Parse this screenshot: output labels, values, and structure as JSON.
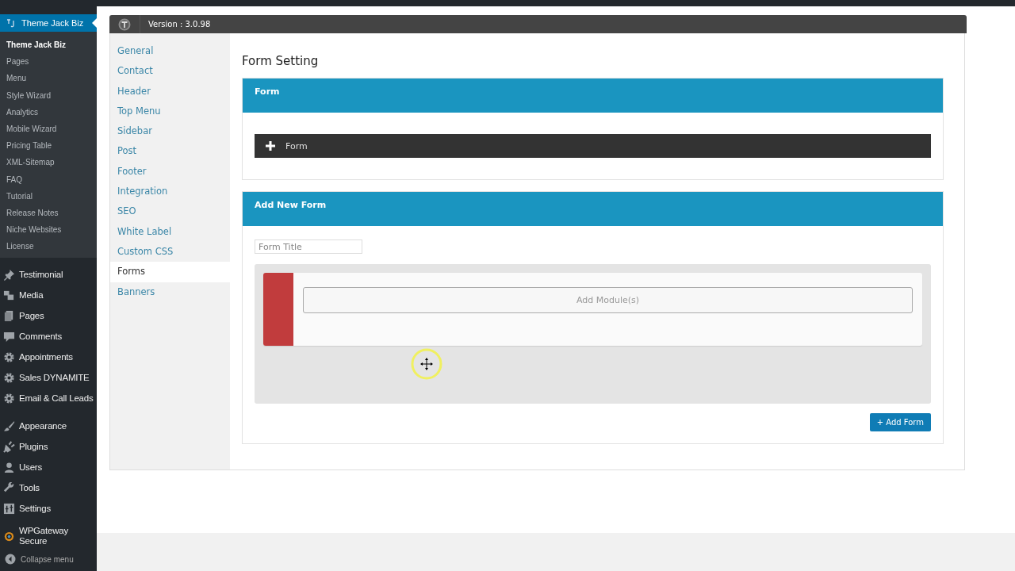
{
  "admin_menu": {
    "header": {
      "label": "Theme Jack Biz",
      "selected": true
    },
    "submenu": [
      {
        "label": "Theme Jack Biz",
        "selected": true
      },
      {
        "label": "Pages",
        "selected": false
      },
      {
        "label": "Menu",
        "selected": false
      },
      {
        "label": "Style Wizard",
        "selected": false
      },
      {
        "label": "Analytics",
        "selected": false
      },
      {
        "label": "Mobile Wizard",
        "selected": false
      },
      {
        "label": "Pricing Table",
        "selected": false
      },
      {
        "label": "XML-Sitemap",
        "selected": false
      },
      {
        "label": "FAQ",
        "selected": false
      },
      {
        "label": "Tutorial",
        "selected": false
      },
      {
        "label": "Release Notes",
        "selected": false
      },
      {
        "label": "Niche Websites",
        "selected": false
      },
      {
        "label": "License",
        "selected": false
      }
    ],
    "groups": [
      [
        {
          "label": "Testimonial",
          "kind": "pin"
        },
        {
          "label": "Media",
          "kind": "media"
        },
        {
          "label": "Pages",
          "kind": "pages"
        },
        {
          "label": "Comments",
          "kind": "comment"
        },
        {
          "label": "Appointments",
          "kind": "gear"
        },
        {
          "label": "Sales DYNAMITE",
          "kind": "gear"
        },
        {
          "label": "Email & Call Leads",
          "kind": "gear"
        }
      ],
      [
        {
          "label": "Appearance",
          "kind": "brush"
        },
        {
          "label": "Plugins",
          "kind": "plug"
        },
        {
          "label": "Users",
          "kind": "user"
        },
        {
          "label": "Tools",
          "kind": "wrench"
        },
        {
          "label": "Settings",
          "kind": "settings"
        }
      ],
      [
        {
          "label": "WPGateway Secure",
          "kind": "ring"
        }
      ]
    ],
    "collapse": "Collapse menu"
  },
  "panel": {
    "version": "Version : 3.0.98",
    "nav": [
      {
        "label": "General",
        "selected": false
      },
      {
        "label": "Contact",
        "selected": false
      },
      {
        "label": "Header",
        "selected": false
      },
      {
        "label": "Top Menu",
        "selected": false
      },
      {
        "label": "Sidebar",
        "selected": false
      },
      {
        "label": "Post",
        "selected": false
      },
      {
        "label": "Footer",
        "selected": false
      },
      {
        "label": "Integration",
        "selected": false
      },
      {
        "label": "SEO",
        "selected": false
      },
      {
        "label": "White Label",
        "selected": false
      },
      {
        "label": "Custom CSS",
        "selected": false
      },
      {
        "label": "Forms",
        "selected": true
      },
      {
        "label": "Banners",
        "selected": false
      }
    ],
    "title": "Form Setting",
    "form_section": {
      "heading": "Form",
      "item": {
        "label": "Form",
        "expanded": false
      }
    },
    "add_section": {
      "heading": "Add New Form",
      "title_field": {
        "placeholder": "Form Title"
      },
      "module_button": "Add Module(s)",
      "submit": "+ Add Form"
    }
  }
}
